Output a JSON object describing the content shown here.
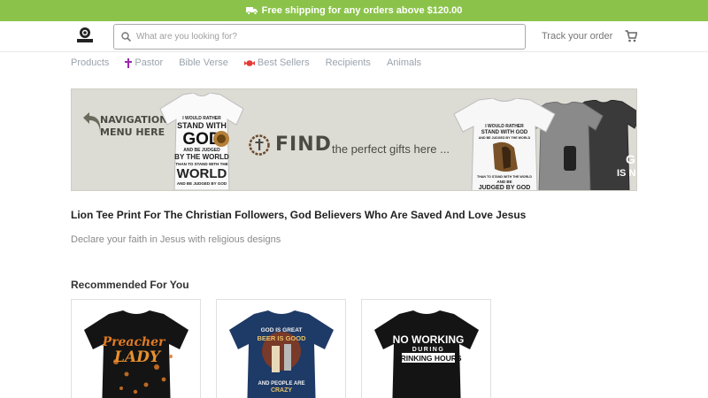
{
  "promo": {
    "text": "Free shipping for any orders above $120.00",
    "icon": "truck-icon"
  },
  "header": {
    "search_placeholder": "What are you looking for?",
    "track_order": "Track your order",
    "cart_icon": "cart-icon"
  },
  "nav": [
    {
      "label": "Products"
    },
    {
      "label": "Pastor",
      "icon": "cross-icon"
    },
    {
      "label": "Bible Verse"
    },
    {
      "label": "Best Sellers",
      "icon": "candy-icon"
    },
    {
      "label": "Recipients"
    },
    {
      "label": "Animals"
    }
  ],
  "banner": {
    "nav_line1": "NAVIGATION",
    "nav_line2": "MENU HERE",
    "find_word": "FIND",
    "tagline": "the perfect gifts here ...",
    "shirt1": [
      "I WOULD RATHER",
      "STAND WITH",
      "GOD",
      "AND BE JUDGED",
      "BY THE WORLD",
      "THAN TO STAND WITH THE",
      "WORLD",
      "AND BE JUDGED BY GOD"
    ],
    "shirt2": [
      "I WOULD RATHER",
      "STAND WITH GOD",
      "AND BE JUDGED BY THE WORLD",
      "THAN TO STAND WITH THE WORLD",
      "AND BE",
      "JUDGED BY GOD"
    ],
    "shirt_back_text": "IS NOT"
  },
  "page": {
    "heading": "Lion Tee Print For The Christian Followers, God Believers Who Are Saved And Love Jesus",
    "subheading": "Declare your faith in Jesus with religious designs"
  },
  "recommended": {
    "title": "Recommended For You",
    "products": [
      {
        "lines": [
          "Preacher",
          "LADY"
        ],
        "color": "#141414"
      },
      {
        "lines": [
          "GOD IS GREAT",
          "BEER IS GOOD",
          "AND PEOPLE ARE",
          "CRAZY"
        ],
        "color": "#1e3a66"
      },
      {
        "lines": [
          "NO WORKING",
          "DURING",
          "DRINKING HOURS"
        ],
        "color": "#141414"
      }
    ]
  },
  "colors": {
    "promo_bg": "#8bc34a",
    "nav_text": "#9aa3ad",
    "accent_purple": "#9c27b0",
    "accent_red": "#e53935"
  }
}
